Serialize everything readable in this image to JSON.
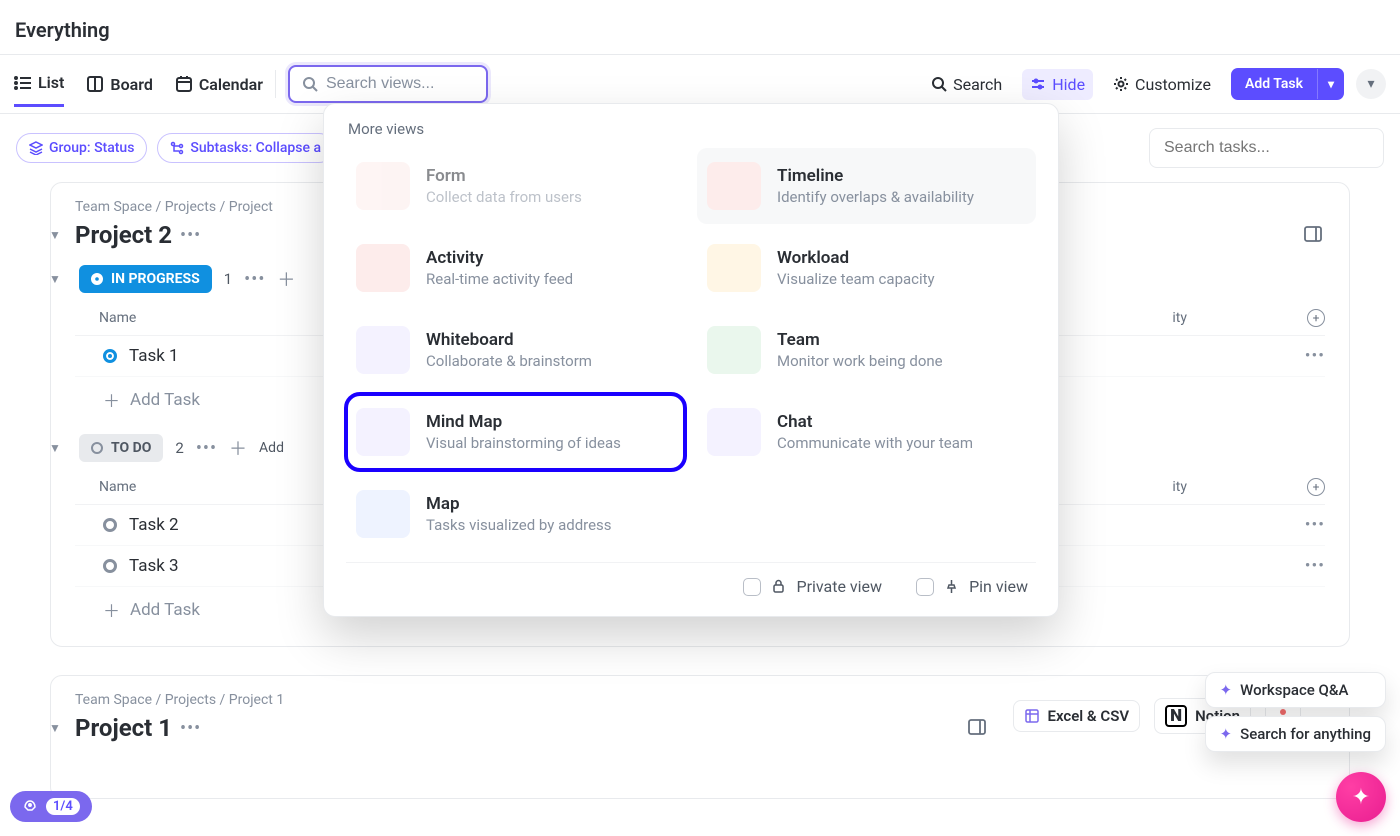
{
  "page_title": "Everything",
  "tabs": {
    "list": "List",
    "board": "Board",
    "calendar": "Calendar"
  },
  "search_views_placeholder": "Search views...",
  "toolbar": {
    "search": "Search",
    "hide": "Hide",
    "customize": "Customize",
    "add_task": "Add Task"
  },
  "filters": {
    "group": "Group: Status",
    "subtasks": "Subtasks: Collapse a"
  },
  "search_tasks_placeholder": "Search tasks...",
  "views_popup": {
    "header": "More views",
    "items": [
      {
        "title": "Form",
        "desc": "Collect data from users",
        "thumb": "red",
        "state": "disabled"
      },
      {
        "title": "Timeline",
        "desc": "Identify overlaps & availability",
        "thumb": "red",
        "state": "hovered"
      },
      {
        "title": "Activity",
        "desc": "Real-time activity feed",
        "thumb": "red",
        "state": ""
      },
      {
        "title": "Workload",
        "desc": "Visualize team capacity",
        "thumb": "yellow",
        "state": ""
      },
      {
        "title": "Whiteboard",
        "desc": "Collaborate & brainstorm",
        "thumb": "purple",
        "state": ""
      },
      {
        "title": "Team",
        "desc": "Monitor work being done",
        "thumb": "green",
        "state": ""
      },
      {
        "title": "Mind Map",
        "desc": "Visual brainstorming of ideas",
        "thumb": "purple",
        "state": "highlighted"
      },
      {
        "title": "Chat",
        "desc": "Communicate with your team",
        "thumb": "purple",
        "state": ""
      },
      {
        "title": "Map",
        "desc": "Tasks visualized by address",
        "thumb": "blue",
        "state": ""
      }
    ],
    "footer": {
      "private": "Private view",
      "pin": "Pin view"
    }
  },
  "project2": {
    "breadcrumb": "Team Space / Projects / Project",
    "title": "Project 2",
    "sections": [
      {
        "status": "IN PROGRESS",
        "count": "1",
        "col_name": "Name",
        "col_right": "ity",
        "tasks": [
          {
            "name": "Task 1"
          }
        ],
        "add_label": "Add Task"
      },
      {
        "status": "TO DO",
        "count": "2",
        "add_inline": "Add",
        "col_name": "Name",
        "col_right": "ity",
        "tasks": [
          {
            "name": "Task 2"
          },
          {
            "name": "Task 3"
          }
        ],
        "add_label": "Add Task"
      }
    ]
  },
  "project1": {
    "breadcrumb": "Team Space / Projects / Project 1",
    "title": "Project 1",
    "imports": {
      "excel": "Excel & CSV",
      "notion": "Notion"
    }
  },
  "assist": {
    "qa": "Workspace Q&A",
    "search": "Search for anything"
  },
  "onboarding": {
    "count": "1/4"
  }
}
